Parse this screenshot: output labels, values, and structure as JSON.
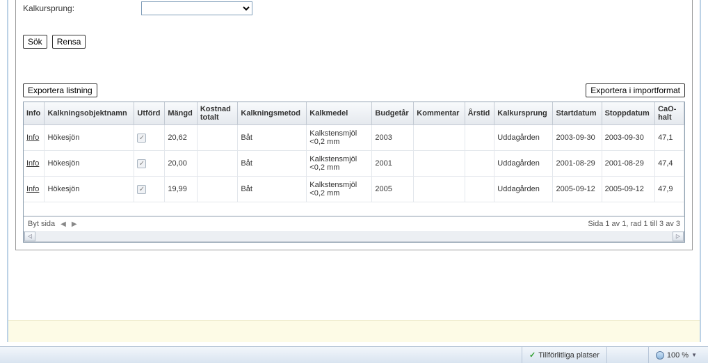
{
  "filter": {
    "label": "Kalkursprung:"
  },
  "buttons": {
    "search": "Sök",
    "clear": "Rensa",
    "export_list": "Exportera listning",
    "export_import": "Exportera i importformat"
  },
  "columns": [
    "Info",
    "Kalkningsobjektnamn",
    "Utförd",
    "Mängd",
    "Kostnad totalt",
    "Kalkningsmetod",
    "Kalkmedel",
    "Budgetår",
    "Kommentar",
    "Årstid",
    "Kalkursprung",
    "Startdatum",
    "Stoppdatum",
    "CaO-halt"
  ],
  "rows": [
    {
      "info": "Info",
      "namn": "Hökesjön",
      "utford": true,
      "mangd": "20,62",
      "kostnad": "",
      "metod": "Båt",
      "medel": "Kalkstensmjöl <0,2 mm",
      "budgetar": "2003",
      "kommentar": "",
      "arstid": "",
      "ursprung": "Uddagården",
      "start": "2003-09-30",
      "stopp": "2003-09-30",
      "cao": "47,1"
    },
    {
      "info": "Info",
      "namn": "Hökesjön",
      "utford": true,
      "mangd": "20,00",
      "kostnad": "",
      "metod": "Båt",
      "medel": "Kalkstensmjöl <0,2 mm",
      "budgetar": "2001",
      "kommentar": "",
      "arstid": "",
      "ursprung": "Uddagården",
      "start": "2001-08-29",
      "stopp": "2001-08-29",
      "cao": "47,4"
    },
    {
      "info": "Info",
      "namn": "Hökesjön",
      "utford": true,
      "mangd": "19,99",
      "kostnad": "",
      "metod": "Båt",
      "medel": "Kalkstensmjöl <0,2 mm",
      "budgetar": "2005",
      "kommentar": "",
      "arstid": "",
      "ursprung": "Uddagården",
      "start": "2005-09-12",
      "stopp": "2005-09-12",
      "cao": "47,9"
    }
  ],
  "pager": {
    "label": "Byt sida",
    "status": "Sida 1 av 1, rad 1 till 3 av 3"
  },
  "statusbar": {
    "trusted": "Tillförlitliga platser",
    "zoom": "100 %"
  }
}
